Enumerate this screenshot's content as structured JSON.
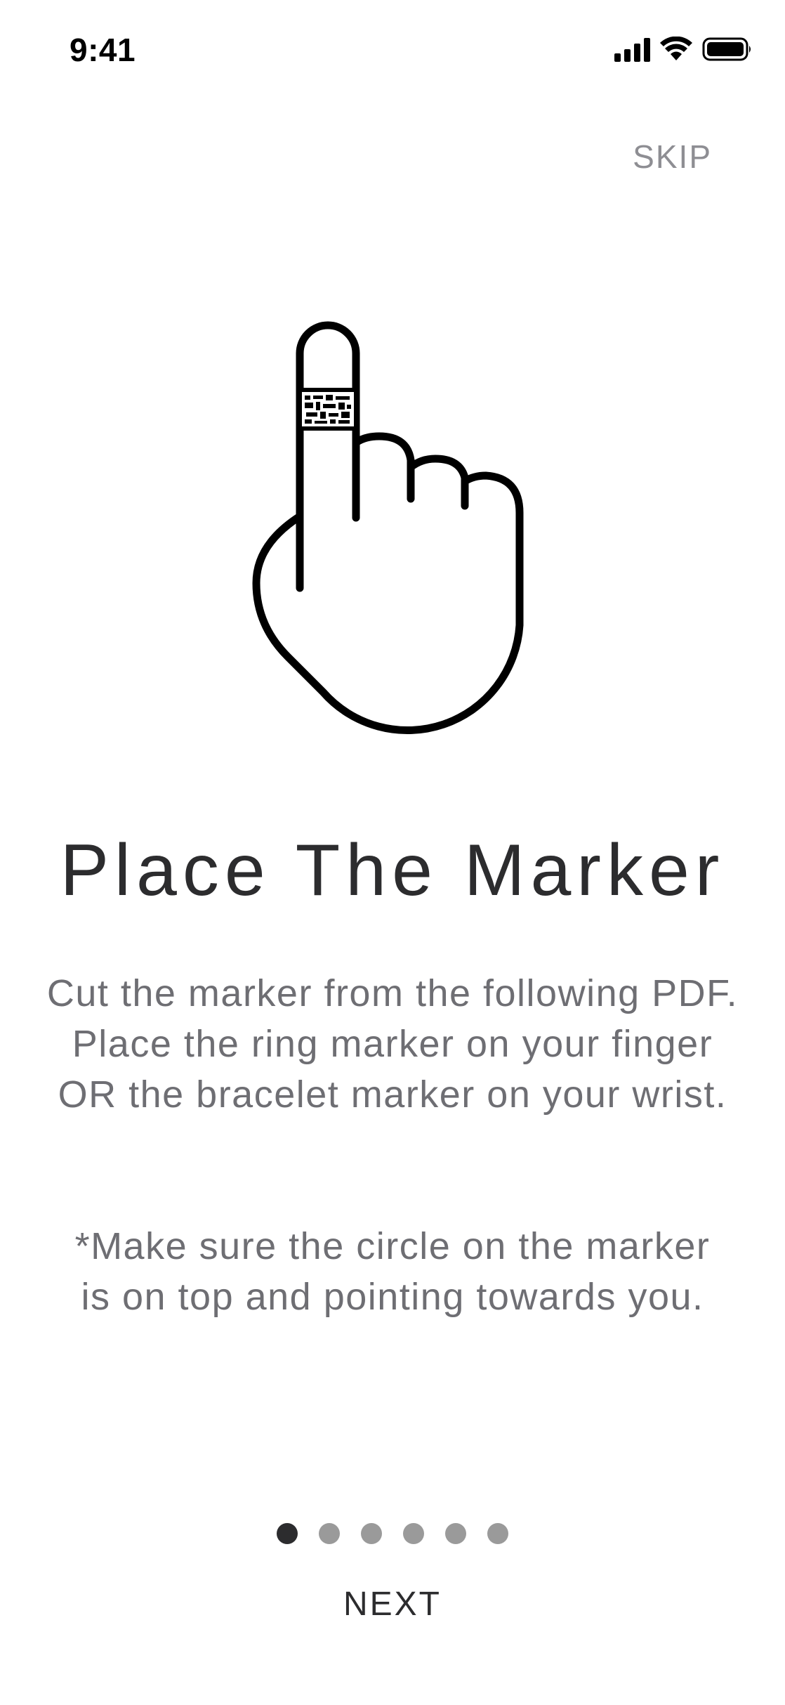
{
  "status_bar": {
    "time": "9:41",
    "icons": [
      "cellular-signal-icon",
      "wifi-icon",
      "battery-icon"
    ]
  },
  "header": {
    "skip_label": "SKIP"
  },
  "illustration": {
    "icon": "finger-ring-marker-icon"
  },
  "content": {
    "title": "Place The Marker",
    "body": "Cut the marker from the following PDF. Place the ring marker on your finger OR the bracelet marker on your wrist.",
    "note": "*Make sure the circle on the marker is on top and pointing towards you."
  },
  "pagination": {
    "total": 6,
    "current": 1
  },
  "footer": {
    "next_label": "NEXT"
  },
  "colors": {
    "active_dot": "#2c2c2e",
    "inactive_dot": "#9a9a9a",
    "skip_text": "#8e8e93",
    "body_text": "#6e6e73"
  }
}
